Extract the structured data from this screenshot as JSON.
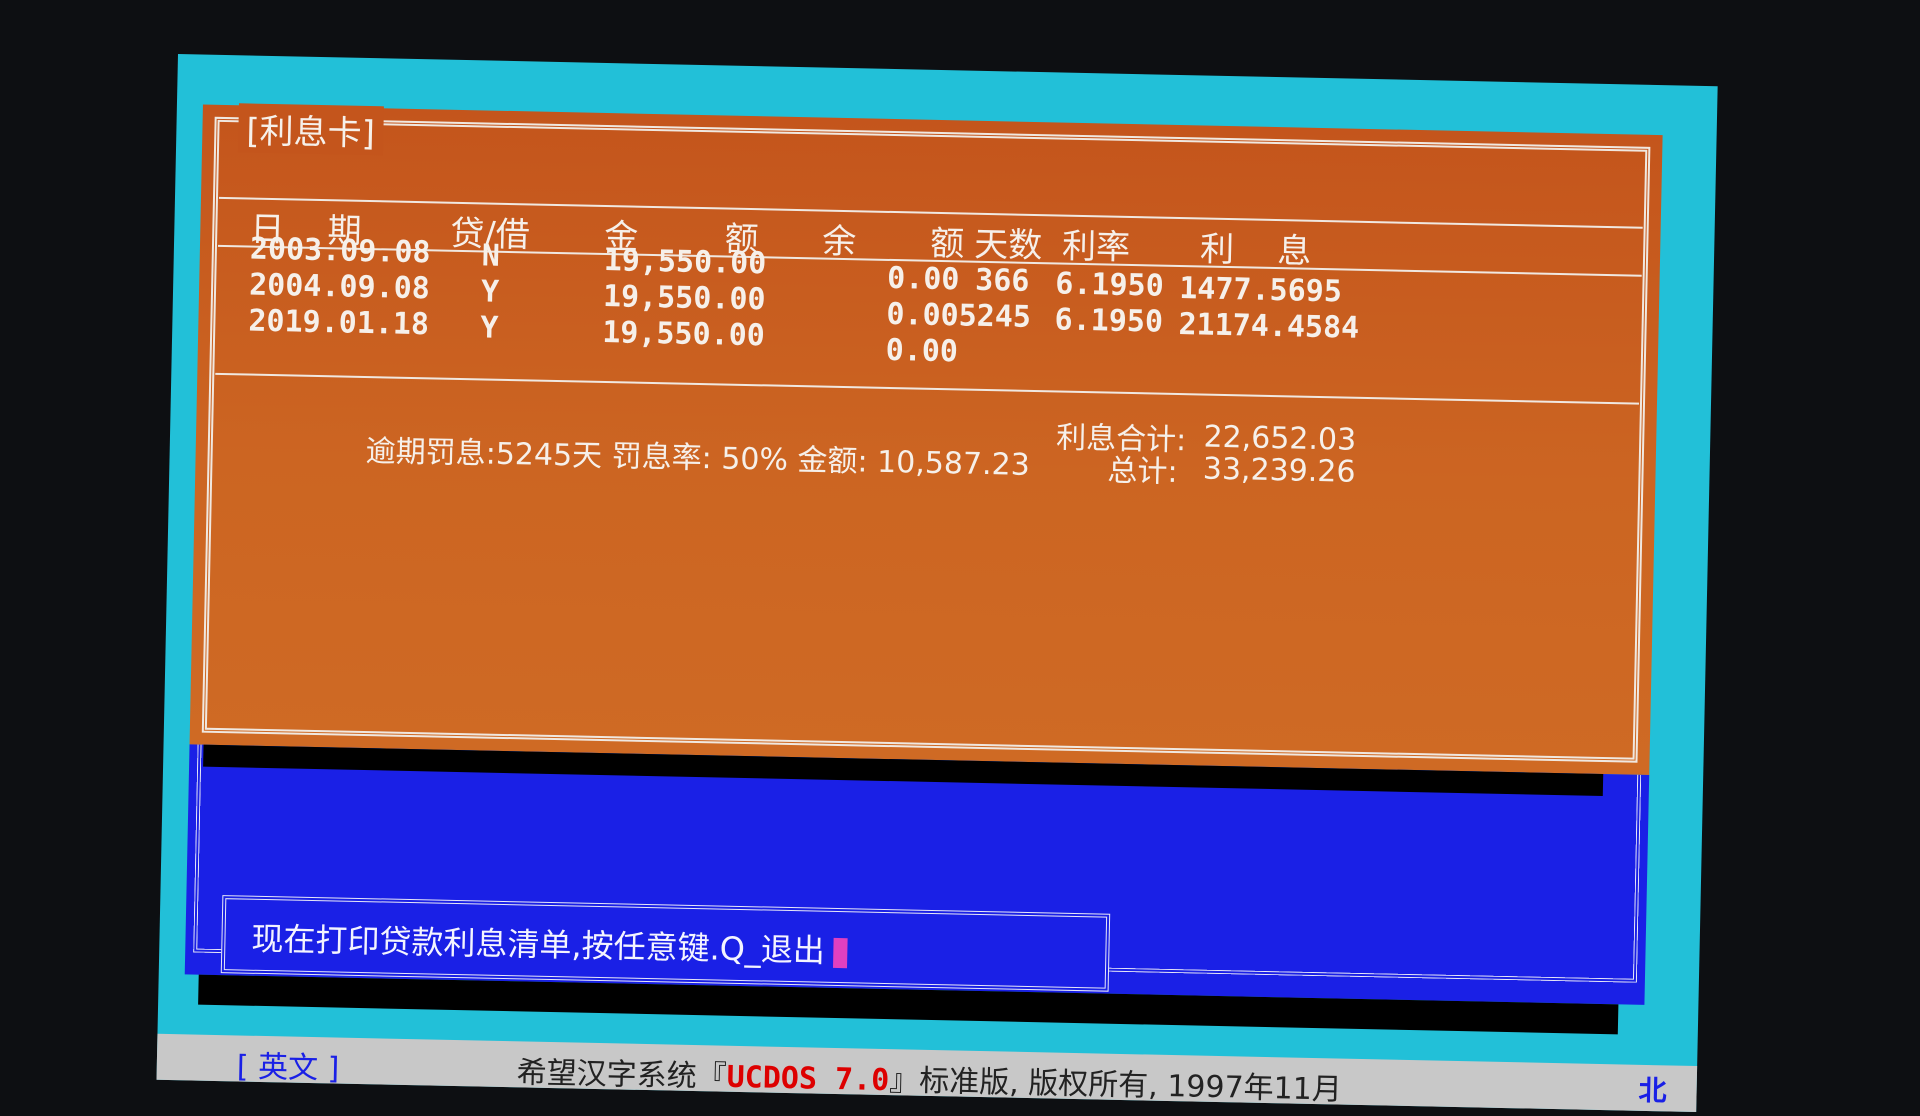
{
  "card": {
    "title": "[利息卡]",
    "headers": {
      "date": "日    期",
      "loan": "贷/借",
      "amount": "金        额",
      "balance_l": "余",
      "balance_r": "额",
      "days": "天数",
      "rate": "利率",
      "interest": "利    息"
    },
    "rows": [
      {
        "date": "2003.09.08",
        "flag": "N",
        "amount": "19,550.00",
        "balance": "0.00",
        "days": "366",
        "rate": "6.1950",
        "interest": "1477.5695"
      },
      {
        "date": "2004.09.08",
        "flag": "Y",
        "amount": "19,550.00",
        "balance": "0.00",
        "days": "5245",
        "rate": "6.1950",
        "interest": "21174.4584"
      },
      {
        "date": "2019.01.18",
        "flag": "Y",
        "amount": "19,550.00",
        "balance": "0.00",
        "days": "",
        "rate": "",
        "interest": ""
      }
    ],
    "penalty_line": "逾期罚息:5245天 罚息率: 50% 金额: 10,587.23",
    "interest_total_label": "利息合计:",
    "interest_total_value": "22,652.03",
    "grand_total_label": "总计:",
    "grand_total_value": "33,239.26"
  },
  "prompt": {
    "message": "现在打印贷款利息清单,按任意键.Q_退出"
  },
  "status": {
    "left": "[ 英文 ]",
    "prefix": "希望汉字系统『",
    "brand": "UCDOS 7.0",
    "suffix": "』标准版, 版权所有, 1997年11月",
    "icon": "北"
  },
  "colors": {
    "screen_bg": "#22c0d8",
    "card_bg": "#c95e20",
    "panel_blue": "#1a20e6",
    "cursor": "#e040c0",
    "brand_red": "#dd0000"
  }
}
